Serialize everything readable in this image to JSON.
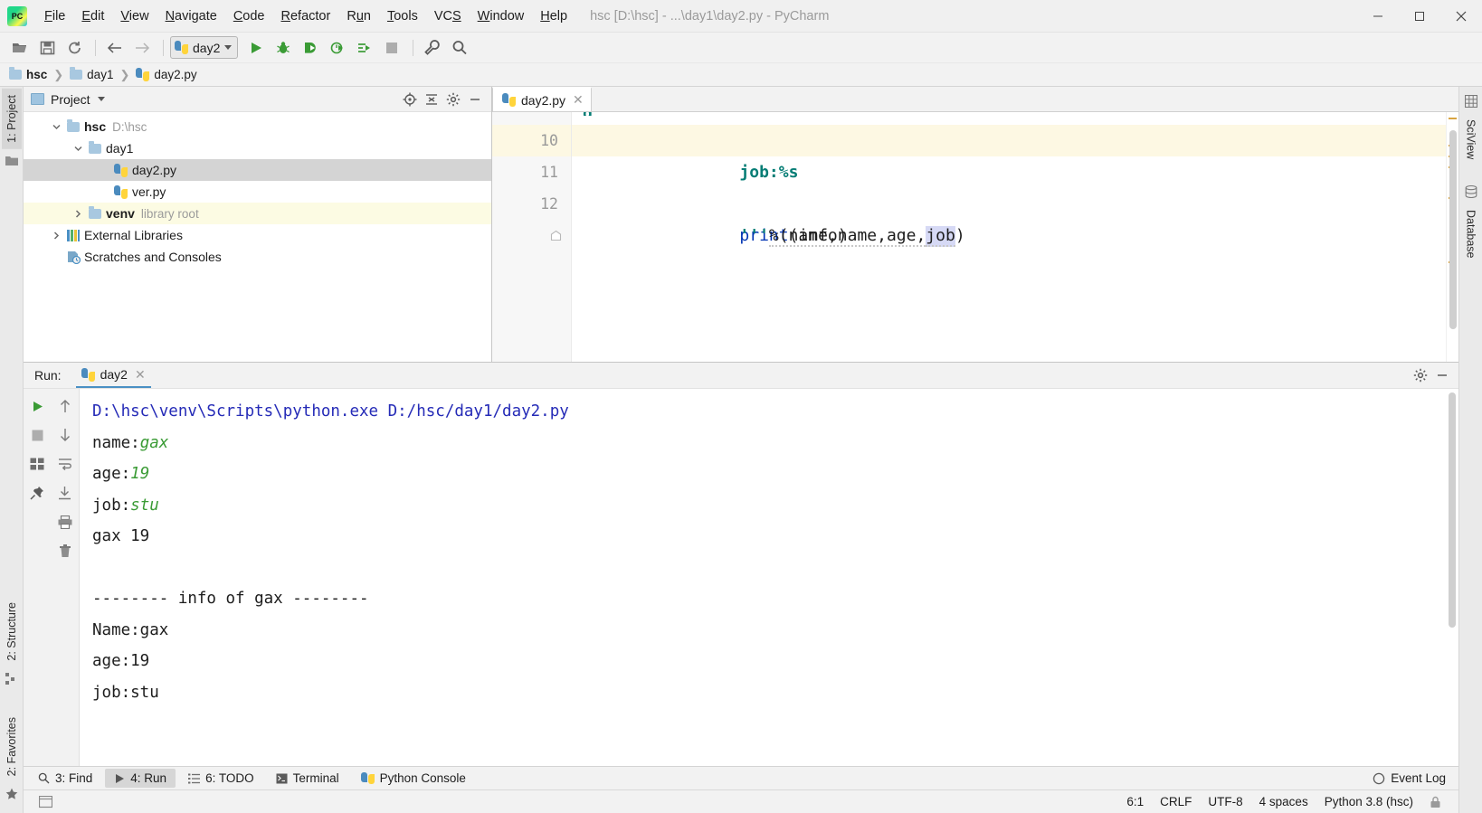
{
  "window": {
    "title": "hsc [D:\\hsc] - ...\\day1\\day2.py - PyCharm",
    "minimize": "─",
    "maximize": "□",
    "close": "✕"
  },
  "menu": [
    {
      "label": "File",
      "mnemonic": "F"
    },
    {
      "label": "Edit",
      "mnemonic": "E"
    },
    {
      "label": "View",
      "mnemonic": "V"
    },
    {
      "label": "Navigate",
      "mnemonic": "N"
    },
    {
      "label": "Code",
      "mnemonic": "C"
    },
    {
      "label": "Refactor",
      "mnemonic": "R"
    },
    {
      "label": "Run",
      "mnemonic": "u"
    },
    {
      "label": "Tools",
      "mnemonic": "T"
    },
    {
      "label": "VCS",
      "mnemonic": "S"
    },
    {
      "label": "Window",
      "mnemonic": "W"
    },
    {
      "label": "Help",
      "mnemonic": "H"
    }
  ],
  "toolbar": {
    "icons": [
      "open-folder-icon",
      "save-icon",
      "sync-icon",
      "back-arrow-icon",
      "forward-arrow-icon"
    ],
    "run_config": "day2",
    "run_icons": [
      "run-icon",
      "debug-icon",
      "run-with-coverage-icon",
      "profile-icon",
      "run-tests-icon",
      "stop-icon"
    ],
    "right_icons": [
      "wrench-icon",
      "search-icon"
    ]
  },
  "breadcrumb": [
    {
      "label": "hsc",
      "icon": "folder-icon",
      "bold": true
    },
    {
      "label": "day1",
      "icon": "folder-icon",
      "bold": false
    },
    {
      "label": "day2.py",
      "icon": "python-file-icon",
      "bold": false
    }
  ],
  "left_strip": {
    "tabs": [
      "1: Project",
      "2: Structure",
      "2: Favorites"
    ],
    "icons": [
      "folder-icon",
      "structure-icon",
      "star-icon"
    ]
  },
  "right_strip": {
    "tabs": [
      "SciView",
      "Database"
    ],
    "icons": [
      "grid-icon",
      "database-icon"
    ]
  },
  "project_panel": {
    "title": "Project",
    "header_icons": [
      "locate-icon",
      "collapse-all-icon",
      "gear-icon",
      "hide-icon"
    ],
    "tree": [
      {
        "label": "hsc",
        "sub": "D:\\hsc",
        "icon": "folder-icon",
        "arrow": "expanded",
        "indent": 0,
        "bold": true,
        "state": "normal"
      },
      {
        "label": "day1",
        "sub": "",
        "icon": "folder-icon",
        "arrow": "expanded",
        "indent": 1,
        "bold": false,
        "state": "normal"
      },
      {
        "label": "day2.py",
        "sub": "",
        "icon": "python-file-icon",
        "arrow": "none",
        "indent": 2,
        "bold": false,
        "state": "selected"
      },
      {
        "label": "ver.py",
        "sub": "",
        "icon": "python-file-icon",
        "arrow": "none",
        "indent": 2,
        "bold": false,
        "state": "normal"
      },
      {
        "label": "venv",
        "sub": "library root",
        "icon": "folder-icon",
        "arrow": "collapsed",
        "indent": 1,
        "bold": true,
        "state": "venv"
      },
      {
        "label": "External Libraries",
        "sub": "",
        "icon": "library-icon",
        "arrow": "collapsed",
        "indent": 0,
        "bold": false,
        "state": "normal"
      },
      {
        "label": "Scratches and Consoles",
        "sub": "",
        "icon": "scratches-icon",
        "arrow": "none",
        "indent": 0,
        "bold": false,
        "state": "normal"
      }
    ]
  },
  "editor": {
    "tab": {
      "label": "day2.py",
      "icon": "python-file-icon",
      "close": "✕"
    },
    "clipped_line": "g",
    "lines": [
      {
        "number": "10",
        "highlight": true,
        "tokens": [
          {
            "t": "job:%s",
            "c": "s-str"
          }
        ]
      },
      {
        "number": "11",
        "highlight": false,
        "fold": true,
        "tokens": [
          {
            "t": "'''",
            "c": "s-str"
          },
          {
            "t": "%(name,name,age,",
            "c": "s-plain"
          },
          {
            "t": "job",
            "c": "s-sel"
          },
          {
            "t": ")",
            "c": "s-plain"
          }
        ]
      },
      {
        "number": "12",
        "highlight": false,
        "tokens": [
          {
            "t": "print",
            "c": "s-kw"
          },
          {
            "t": "(info)",
            "c": "s-plain"
          }
        ]
      }
    ]
  },
  "run_panel": {
    "label": "Run:",
    "tab": {
      "label": "day2",
      "icon": "python-icon",
      "close": "✕"
    },
    "header_icons": [
      "gear-icon",
      "hide-icon"
    ],
    "tool_icons_col1": [
      "rerun-icon",
      "stop-icon",
      "layout-icon",
      "pin-icon"
    ],
    "tool_icons_col2": [
      "up-arrow-icon",
      "down-arrow-icon",
      "soft-wrap-icon",
      "scroll-to-end-icon",
      "print-icon",
      "trash-icon"
    ],
    "console": [
      {
        "type": "cmd",
        "text": "D:\\hsc\\venv\\Scripts\\python.exe D:/hsc/day1/day2.py"
      },
      {
        "type": "mixed",
        "parts": [
          {
            "t": "name:",
            "k": "out"
          },
          {
            "t": "gax",
            "k": "in"
          }
        ]
      },
      {
        "type": "mixed",
        "parts": [
          {
            "t": "age:",
            "k": "out"
          },
          {
            "t": "19",
            "k": "in"
          }
        ]
      },
      {
        "type": "mixed",
        "parts": [
          {
            "t": "job:",
            "k": "out"
          },
          {
            "t": "stu",
            "k": "in"
          }
        ]
      },
      {
        "type": "out",
        "text": "gax 19"
      },
      {
        "type": "out",
        "text": ""
      },
      {
        "type": "out",
        "text": "-------- info of gax --------"
      },
      {
        "type": "out",
        "text": "Name:gax"
      },
      {
        "type": "out",
        "text": "age:19"
      },
      {
        "type": "out",
        "text": "job:stu"
      }
    ]
  },
  "toolwindow_bar": [
    {
      "label": "3: Find",
      "icon": "search-icon",
      "active": false
    },
    {
      "label": "4: Run",
      "icon": "run-icon",
      "active": true
    },
    {
      "label": "6: TODO",
      "icon": "todo-icon",
      "active": false
    },
    {
      "label": "Terminal",
      "icon": "terminal-icon",
      "active": false
    },
    {
      "label": "Python Console",
      "icon": "python-icon",
      "active": false
    }
  ],
  "statusbar": {
    "event_log": "Event Log",
    "event_log_icon": "bell-icon",
    "caret": "6:1",
    "line_sep": "CRLF",
    "encoding": "UTF-8",
    "indent": "4 spaces",
    "interpreter": "Python 3.8 (hsc)",
    "lock_icon": "lock-icon"
  },
  "colors": {
    "accent_green": "#3a9b35",
    "string_teal": "#067d75",
    "keyword_blue": "#0033b3",
    "console_cmd": "#252bb7",
    "highlight_line": "#fdf8e3",
    "selection": "#d6d9f5",
    "venv_row": "#fcfbe3"
  }
}
